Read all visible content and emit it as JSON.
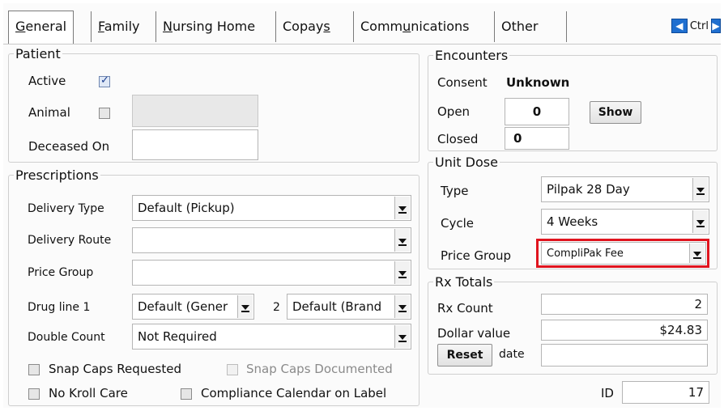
{
  "tabs": [
    {
      "label_u": "G",
      "label_rest": "eneral",
      "prefix": ""
    },
    {
      "label_u": "F",
      "label_rest": "amily",
      "prefix": ""
    },
    {
      "label_u": "N",
      "label_rest": "ursing Home",
      "prefix": ""
    },
    {
      "prefix": "Copay",
      "label_u": "s",
      "label_rest": ""
    },
    {
      "prefix": "Comm",
      "label_u": "u",
      "label_rest": "nications"
    },
    {
      "prefix": "Other",
      "label_u": "",
      "label_rest": ""
    }
  ],
  "nav": {
    "ctrl_label": "Ctrl"
  },
  "patient": {
    "legend": "Patient",
    "active_label": "Active",
    "active_checked": true,
    "animal_label": "Animal",
    "animal_checked": false,
    "animal_value": "",
    "deceased_label": "Deceased On",
    "deceased_value": ""
  },
  "prescriptions": {
    "legend": "Prescriptions",
    "delivery_type_label": "Delivery Type",
    "delivery_type_value": "Default (Pickup)",
    "delivery_route_label": "Delivery Route",
    "delivery_route_value": "",
    "price_group_label": "Price Group",
    "price_group_value": "",
    "drug_line_label": "Drug line 1",
    "drug_line_1_value": "Default (Gener",
    "drug_line_2_label": "2",
    "drug_line_2_value": "Default (Brand",
    "double_count_label": "Double Count",
    "double_count_value": "Not Required",
    "snap_caps_requested_label": "Snap Caps Requested",
    "snap_caps_requested_checked": false,
    "snap_caps_documented_label": "Snap Caps Documented",
    "snap_caps_documented_checked": false,
    "no_kroll_care_label": "No Kroll Care",
    "no_kroll_care_checked": false,
    "compliance_calendar_label": "Compliance Calendar on Label",
    "compliance_calendar_checked": false
  },
  "encounters": {
    "legend": "Encounters",
    "consent_label": "Consent",
    "consent_value": "Unknown",
    "open_label": "Open",
    "open_value": "0",
    "show_button": "Show",
    "closed_label": "Closed",
    "closed_value": "0"
  },
  "unit_dose": {
    "legend": "Unit Dose",
    "type_label": "Type",
    "type_value": "Pilpak 28 Day",
    "cycle_label": "Cycle",
    "cycle_value": "4 Weeks",
    "price_group_label": "Price Group",
    "price_group_value": "CompliPak Fee"
  },
  "rx_totals": {
    "legend": "Rx Totals",
    "rx_count_label": "Rx Count",
    "rx_count_value": "2",
    "dollar_value_label": "Dollar value",
    "dollar_value": "$24.83",
    "reset_button": "Reset",
    "date_label": "date",
    "date_value": ""
  },
  "id": {
    "label": "ID",
    "value": "17"
  },
  "colors": {
    "highlight": "#e0141e",
    "nav_arrow": "#1f6fd0"
  }
}
